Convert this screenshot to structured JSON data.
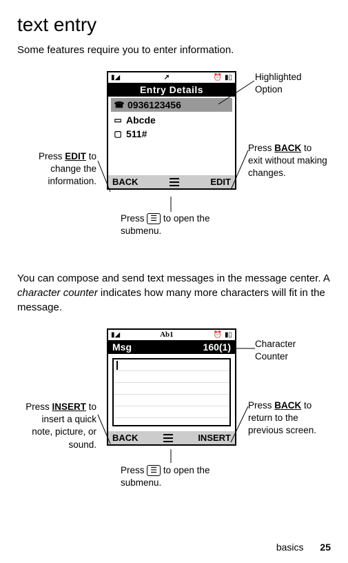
{
  "heading": "text entry",
  "intro": "Some features require you to enter information.",
  "screen1": {
    "title": "Entry Details",
    "row1": "0936123456",
    "row2": "Abcde",
    "row3": "511#",
    "left_softkey": "BACK",
    "right_softkey": "EDIT"
  },
  "callouts1": {
    "highlighted": "Highlighted Option",
    "back_prefix": "Press ",
    "back_label": "BACK",
    "back_suffix": " to exit without making changes.",
    "edit_prefix": "Press ",
    "edit_label": "EDIT",
    "edit_suffix": " to change the information.",
    "menu_prefix": "Press ",
    "menu_key": "☰",
    "menu_suffix": " to open the submenu."
  },
  "para2": "You can compose and send text messages in the message center. A character counter indicates how many more characters will fit in the message.",
  "screen2": {
    "mode": "Ab1",
    "title": "Msg",
    "counter": "160(1)",
    "left_softkey": "BACK",
    "right_softkey": "INSERT"
  },
  "callouts2": {
    "counter": "Character Counter",
    "insert_prefix": "Press ",
    "insert_label": "INSERT",
    "insert_suffix": " to insert a quick note, picture, or sound.",
    "back_prefix": "Press ",
    "back_label": "BACK",
    "back_suffix": " to return to the previous screen.",
    "menu_prefix": "Press ",
    "menu_key": "☰",
    "menu_suffix": " to open the submenu."
  },
  "footer_label": "basics",
  "footer_page": "25"
}
